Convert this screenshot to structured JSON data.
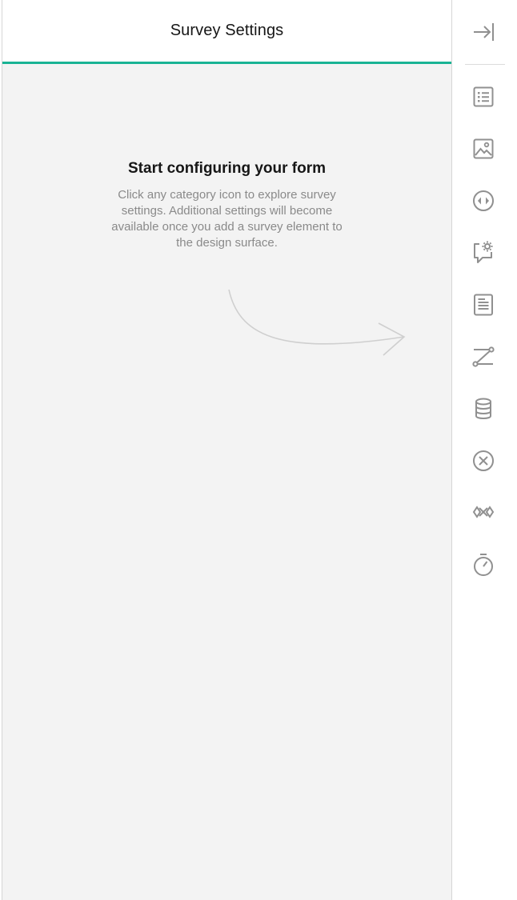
{
  "panel": {
    "title": "Survey Settings",
    "accent_color": "#19b394"
  },
  "placeholder": {
    "title": "Start configuring your form",
    "description": "Click any category icon to explore survey settings. Additional settings will become available once you add a survey element to the design surface."
  },
  "sidebar": {
    "collapse_icon": "collapse-right-icon",
    "categories": [
      {
        "icon": "list-icon"
      },
      {
        "icon": "image-icon"
      },
      {
        "icon": "navigation-icon"
      },
      {
        "icon": "question-settings-icon"
      },
      {
        "icon": "pages-icon"
      },
      {
        "icon": "logic-icon"
      },
      {
        "icon": "data-icon"
      },
      {
        "icon": "validation-icon"
      },
      {
        "icon": "show-on-completion-icon"
      },
      {
        "icon": "timer-icon"
      }
    ]
  }
}
